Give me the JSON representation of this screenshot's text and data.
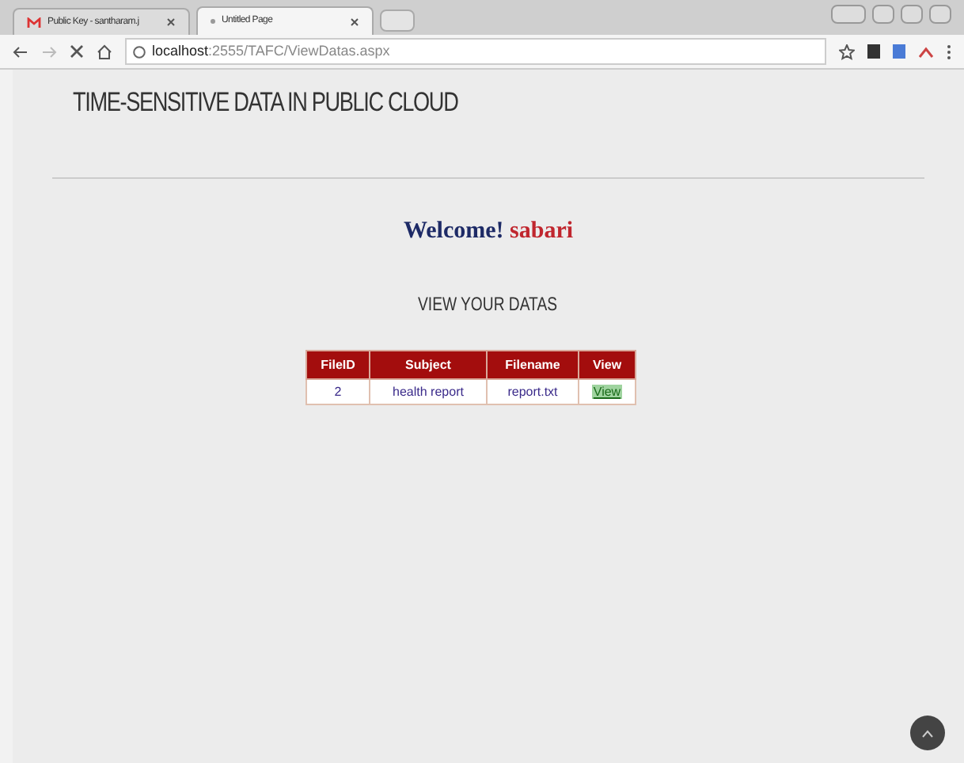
{
  "tabs": [
    {
      "label": "Public Key - santharam.j",
      "selected": false,
      "kind": "mail"
    },
    {
      "label": "Untitled Page",
      "selected": true,
      "kind": "page"
    }
  ],
  "address": {
    "host": "localhost",
    "path": ":2555/TAFC/ViewDatas.aspx"
  },
  "site_title": "TIME-SENSITIVE DATA IN PUBLIC CLOUD",
  "welcome": {
    "greeting": "Welcome!",
    "user": "sabari"
  },
  "section_title": "VIEW YOUR DATAS",
  "table": {
    "columns": [
      "FileID",
      "Subject",
      "Filename",
      "View"
    ],
    "rows": [
      {
        "cells": [
          "2",
          "health report",
          "report.txt",
          "View"
        ]
      }
    ]
  }
}
